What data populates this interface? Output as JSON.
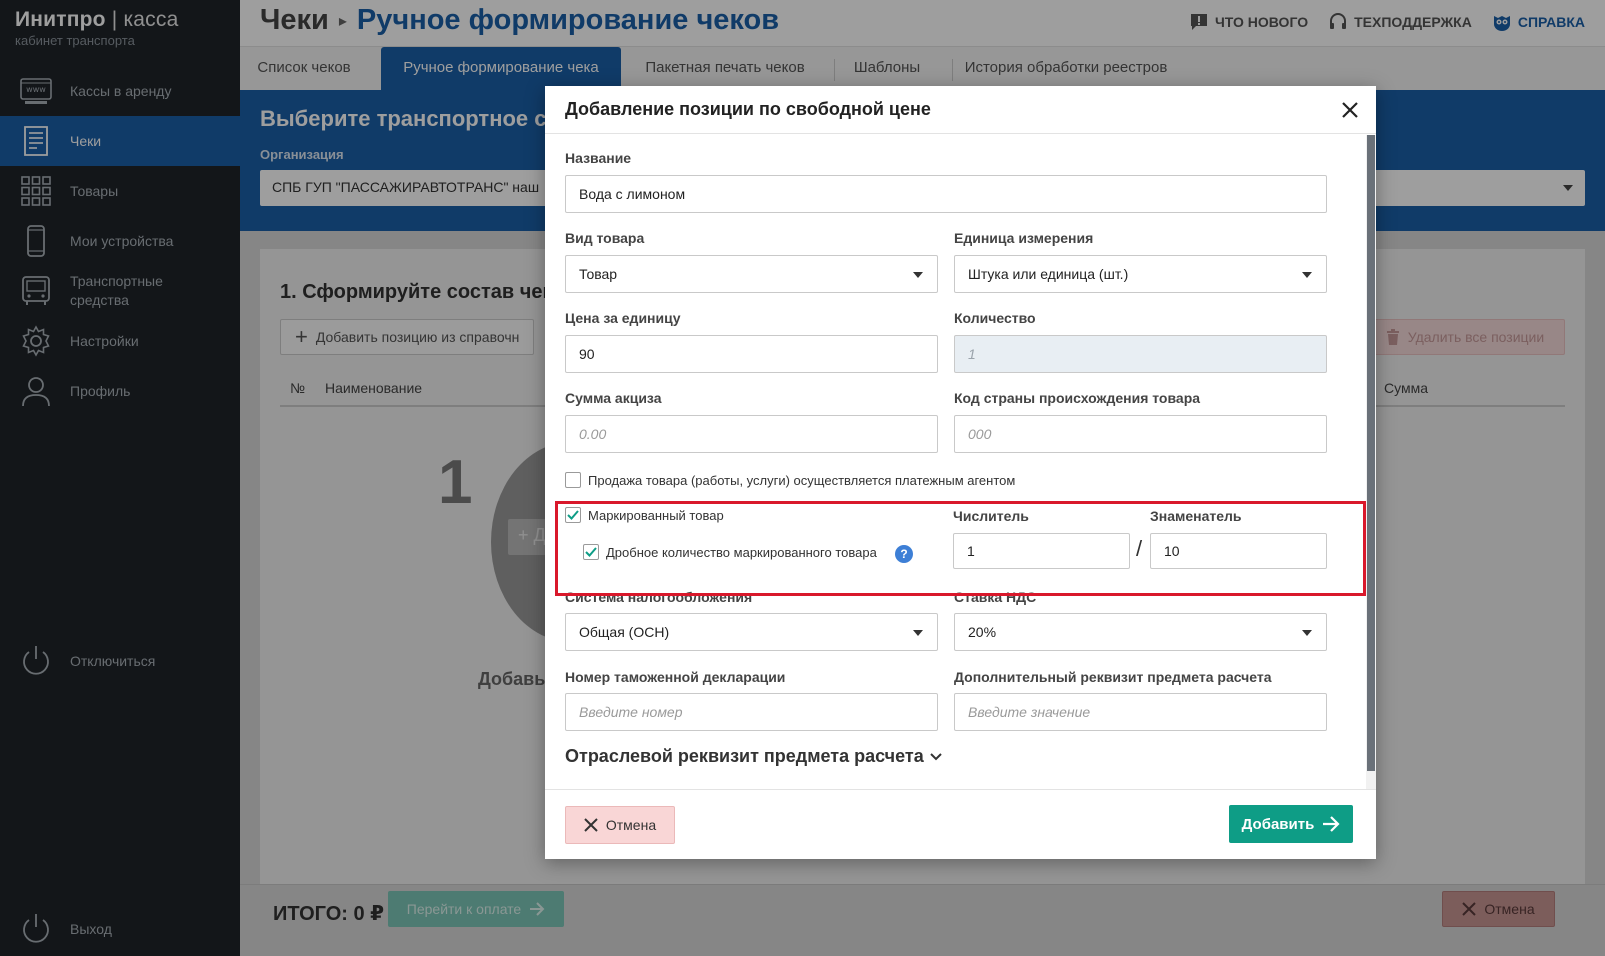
{
  "brand": {
    "title_bold": "Инитпро",
    "title_sep": " | ",
    "title_thin": "касса",
    "subtitle": "кабинет транспорта"
  },
  "sidebar": {
    "items": [
      {
        "label": "Кассы в аренду",
        "icon": "www-icon"
      },
      {
        "label": "Чеки",
        "icon": "receipt-icon",
        "active": true
      },
      {
        "label": "Товары",
        "icon": "grid-icon"
      },
      {
        "label": "Мои устройства",
        "icon": "phone-icon"
      },
      {
        "label": "Транспортные средства",
        "icon": "bus-icon"
      },
      {
        "label": "Настройки",
        "icon": "gear-icon"
      },
      {
        "label": "Профиль",
        "icon": "user-icon"
      }
    ],
    "disconnect": "Отключиться",
    "logout": "Выход"
  },
  "header": {
    "crumb1": "Чеки",
    "crumb_sep": "▸",
    "crumb2": "Ручное формирование чеков",
    "links": {
      "whats_new": "ЧТО НОВОГО",
      "support": "ТЕХПОДДЕРЖКА",
      "help": "СПРАВКА"
    }
  },
  "tabs": [
    "Список чеков",
    "Ручное формирование чека",
    "Пакетная печать чеков",
    "Шаблоны",
    "История обработки реестров"
  ],
  "panel": {
    "title": "Выберите транспортное с",
    "org_label": "Организация",
    "org_value": "СПБ ГУП \"ПАССАЖИРАВТОТРАНС\" наш"
  },
  "content": {
    "step_title": "1. Сформируйте состав чек",
    "add_from_ref": "Добавить позицию из справочн",
    "delete_all": "Удалить все позиции",
    "col_num": "№",
    "col_name": "Наименование",
    "col_sum": "Сумма",
    "empty_num": "1",
    "empty_add": "+ Д",
    "empty_text": "Добавь"
  },
  "footer": {
    "total": "ИТОГО: 0 ₽",
    "pay": "Перейти к оплате",
    "cancel": "Отмена"
  },
  "modal": {
    "title": "Добавление позиции по свободной цене",
    "name_label": "Название",
    "name_value": "Вода с лимоном",
    "kind_label": "Вид товара",
    "kind_value": "Товар",
    "unit_label": "Единица измерения",
    "unit_value": "Штука или единица (шт.)",
    "price_label": "Цена за единицу",
    "price_value": "90",
    "qty_label": "Количество",
    "qty_value": "1",
    "excise_label": "Сумма акциза",
    "excise_placeholder": "0.00",
    "country_label": "Код страны происхождения товара",
    "country_placeholder": "000",
    "agent_label": "Продажа товара (работы, услуги) осуществляется платежным агентом",
    "marked_label": "Маркированный товар",
    "fractional_label": "Дробное количество маркированного товара",
    "help_glyph": "?",
    "numerator_label": "Числитель",
    "numerator_value": "1",
    "fraction_sep": "/",
    "denominator_label": "Знаменатель",
    "denominator_value": "10",
    "tax_label": "Система налогообложения",
    "tax_value": "Общая (ОСН)",
    "vat_label": "Ставка НДС",
    "vat_value": "20%",
    "customs_label": "Номер таможенной декларации",
    "customs_placeholder": "Введите номер",
    "extra_label": "Дополнительный реквизит предмета расчета",
    "extra_placeholder": "Введите значение",
    "industry_section": "Отраслевой реквизит предмета расчета",
    "cancel": "Отмена",
    "add": "Добавить"
  },
  "colors": {
    "sidebar": "#1f2429",
    "brand_blue": "#1a5fa8",
    "accent_green": "#0e9d86",
    "highlight_red": "#d9182b"
  }
}
